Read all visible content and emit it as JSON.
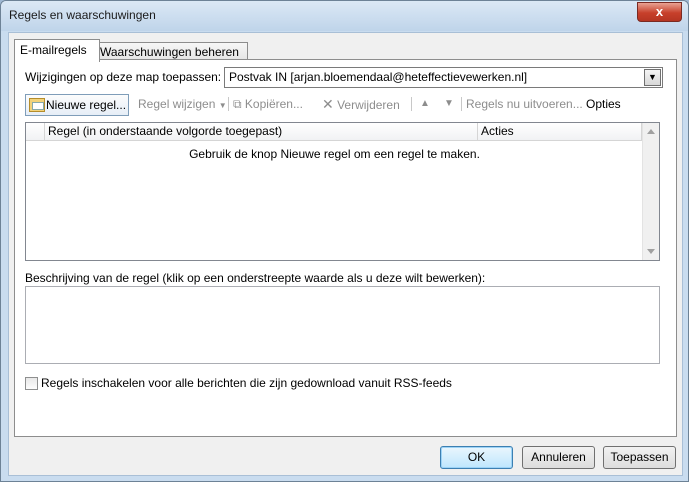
{
  "window": {
    "title": "Regels en waarschuwingen",
    "close_label": "x"
  },
  "tabs": [
    {
      "label": "E-mailregels",
      "active": true
    },
    {
      "label": "Waarschuwingen beheren",
      "active": false
    }
  ],
  "folder": {
    "label": "Wijzigingen op deze map toepassen:",
    "value": "Postvak IN [arjan.bloemendaal@heteffectievewerken.nl]"
  },
  "toolbar": {
    "new_rule": "Nieuwe regel...",
    "change_rule": "Regel wijzigen",
    "copy": "Kopiëren...",
    "delete": "Verwijderen",
    "run_rules": "Regels nu uitvoeren...",
    "options": "Opties"
  },
  "grid": {
    "columns": [
      "Regel (in onderstaande volgorde toegepast)",
      "Acties"
    ],
    "empty_message": "Gebruik de knop Nieuwe regel om een regel te maken."
  },
  "description": {
    "label": "Beschrijving van de regel (klik op een onderstreepte waarde als u deze wilt bewerken):"
  },
  "rss": {
    "label": "Regels inschakelen voor alle berichten die zijn gedownload vanuit RSS-feeds",
    "checked": false
  },
  "buttons": {
    "ok": "OK",
    "cancel": "Annuleren",
    "apply": "Toepassen"
  }
}
